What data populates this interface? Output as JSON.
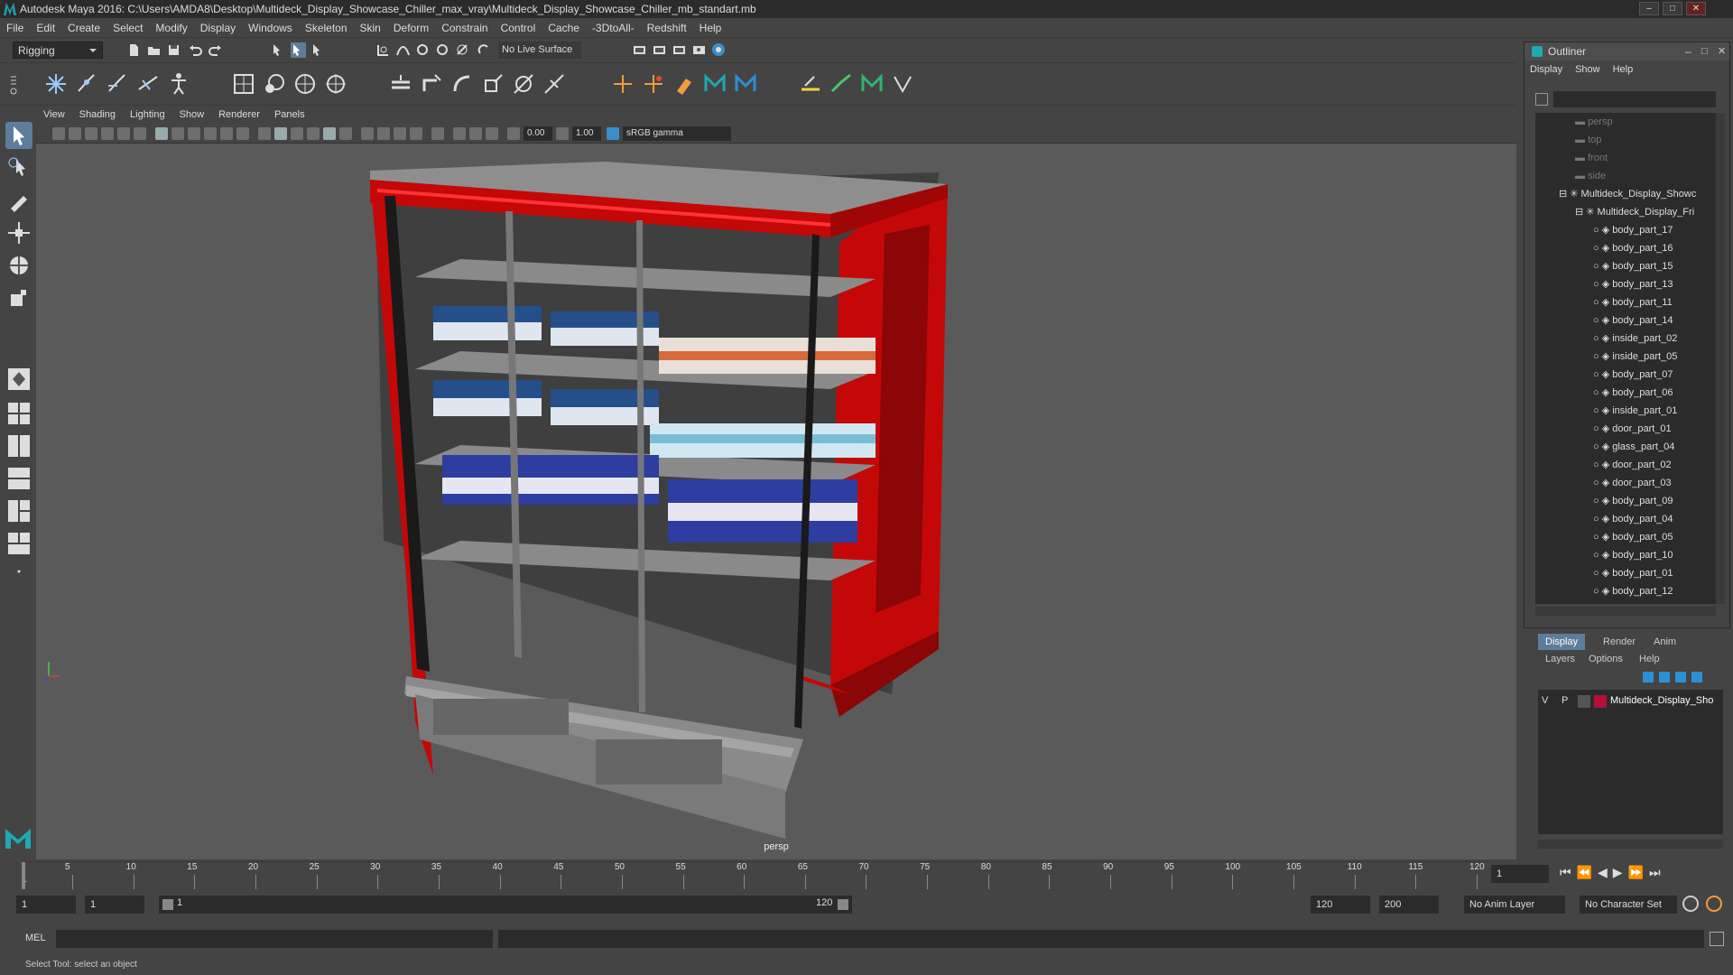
{
  "window": {
    "title": "Autodesk Maya 2016: C:\\Users\\AMDA8\\Desktop\\Multideck_Display_Showcase_Chiller_max_vray\\Multideck_Display_Showcase_Chiller_mb_standart.mb"
  },
  "menubar": [
    "File",
    "Edit",
    "Create",
    "Select",
    "Modify",
    "Display",
    "Windows",
    "Skeleton",
    "Skin",
    "Deform",
    "Constrain",
    "Control",
    "Cache",
    "-3DtoAll-",
    "Redshift",
    "Help"
  ],
  "statusline": {
    "mode": "Rigging",
    "live_surface": "No Live Surface"
  },
  "viewport": {
    "menu": [
      "View",
      "Shading",
      "Lighting",
      "Show",
      "Renderer",
      "Panels"
    ],
    "exposure": "0.00",
    "gamma": "1.00",
    "colorspace": "sRGB gamma",
    "camera_label": "persp"
  },
  "outliner": {
    "title": "Outliner",
    "menu": [
      "Display",
      "Show",
      "Help"
    ],
    "cameras": [
      "persp",
      "top",
      "front",
      "side"
    ],
    "group_root": "Multideck_Display_Showc",
    "group_child": "Multideck_Display_Fri",
    "items": [
      "body_part_17",
      "body_part_16",
      "body_part_15",
      "body_part_13",
      "body_part_11",
      "body_part_14",
      "inside_part_02",
      "inside_part_05",
      "body_part_07",
      "body_part_06",
      "inside_part_01",
      "door_part_01",
      "glass_part_04",
      "door_part_02",
      "door_part_03",
      "body_part_09",
      "body_part_04",
      "body_part_05",
      "body_part_10",
      "body_part_01",
      "body_part_12"
    ]
  },
  "layers": {
    "tabs": [
      "Display",
      "Render",
      "Anim"
    ],
    "menu": [
      "Layers",
      "Options",
      "Help"
    ],
    "layer": {
      "v": "V",
      "p": "P",
      "name": "Multideck_Display_Sho",
      "color": "#b0103a"
    }
  },
  "timeline": {
    "ticks": [
      "5",
      "10",
      "15",
      "20",
      "25",
      "30",
      "35",
      "40",
      "45",
      "50",
      "55",
      "60",
      "65",
      "70",
      "75",
      "80",
      "85",
      "90",
      "95",
      "100",
      "105",
      "110",
      "115",
      "120"
    ],
    "start_marker": "1",
    "current_frame": "1"
  },
  "range": {
    "start": "1",
    "playback_start": "1",
    "slider_start": "1",
    "slider_end": "120",
    "playback_end": "120",
    "end": "200",
    "anim_layer": "No Anim Layer",
    "char_set": "No Character Set"
  },
  "cmdline": {
    "label": "MEL"
  },
  "helpline": "Select Tool: select an object",
  "colors": {
    "chiller_red": "#c40808",
    "viewport_bg": "#5a5a5a",
    "ui_bg": "#444444"
  }
}
